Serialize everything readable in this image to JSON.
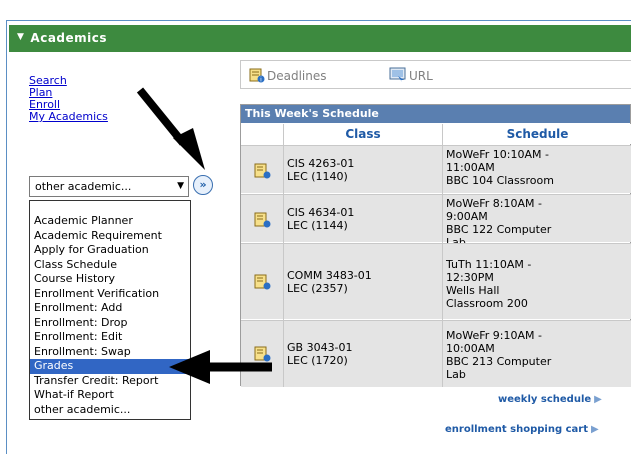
{
  "header": {
    "title": "Academics"
  },
  "links": [
    "Search",
    "Plan",
    "Enroll",
    "My Academics"
  ],
  "select": {
    "value": "other academic...",
    "go_icon": "double-chevron-right-icon"
  },
  "dropdown": {
    "options": [
      "Academic Planner",
      "Academic Requirement",
      "Apply for Graduation",
      "Class Schedule",
      "Course History",
      "Enrollment Verification",
      "Enrollment: Add",
      "Enrollment: Drop",
      "Enrollment: Edit",
      "Enrollment: Swap",
      "Grades",
      "Transfer Credit: Report",
      "What-if Report",
      "other academic..."
    ],
    "selected": "Grades"
  },
  "toolbar": {
    "deadlines": "Deadlines",
    "url": "URL"
  },
  "schedule": {
    "title": "This Week's Schedule",
    "col_class": "Class",
    "col_schedule": "Schedule",
    "rows": [
      {
        "class1": "CIS 4263-01",
        "class2": "LEC (1140)",
        "s1": "MoWeFr 10:10AM -",
        "s2": "11:00AM",
        "s3": "BBC 104 Classroom",
        "s4": ""
      },
      {
        "class1": "CIS 4634-01",
        "class2": "LEC (1144)",
        "s1": "MoWeFr 8:10AM -",
        "s2": "9:00AM",
        "s3": "BBC 122 Computer",
        "s4": "Lab"
      },
      {
        "class1": "COMM 3483-01",
        "class2": "LEC (2357)",
        "s1": "TuTh 11:10AM -",
        "s2": "12:30PM",
        "s3": "Wells Hall",
        "s4": "Classroom 200"
      },
      {
        "class1": "GB 3043-01",
        "class2": "LEC (1720)",
        "s1": "MoWeFr 9:10AM -",
        "s2": "10:00AM",
        "s3": "BBC 213 Computer",
        "s4": "Lab"
      }
    ]
  },
  "footer": {
    "weekly": "weekly schedule",
    "cart": "enrollment shopping cart"
  },
  "colors": {
    "header_green": "#3d8a3f",
    "table_blue": "#5a7fb0",
    "link_blue": "#0000cc",
    "selected_blue": "#3166c4"
  }
}
